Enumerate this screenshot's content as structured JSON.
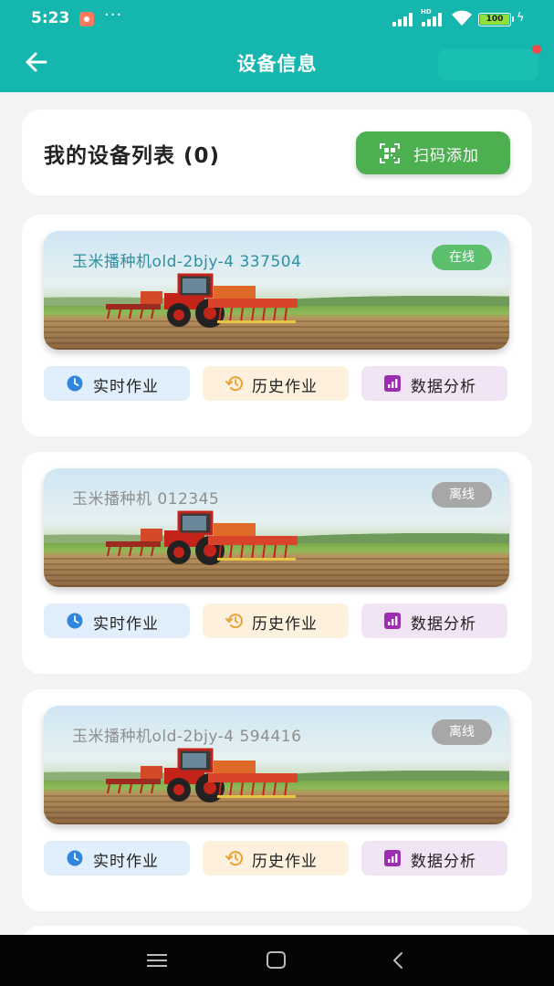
{
  "status_bar": {
    "time": "5:23",
    "more": "···",
    "hd": "HD",
    "battery": "100",
    "colors": {
      "recording_icon": "#ff7a5c",
      "battery_fill": "#8fe03a"
    }
  },
  "header": {
    "title": "设备信息",
    "background": "#15b6ad",
    "back_icon": "arrow-left-icon"
  },
  "device_list": {
    "title": "我的设备列表 (0)",
    "scan_button": {
      "label": "扫码添加",
      "icon": "qr-scan-icon",
      "color": "#4caf50"
    }
  },
  "devices": [
    {
      "name": "玉米播种机old-2bjy-4 337504",
      "status": "在线",
      "status_color": "#5cbf6e",
      "name_color": "#2f8fa2"
    },
    {
      "name": "玉米播种机 012345",
      "status": "离线",
      "status_color": "#a7a7a7",
      "name_color": "#8e8e8e"
    },
    {
      "name": "玉米播种机old-2bjy-4 594416",
      "status": "离线",
      "status_color": "#a7a7a7",
      "name_color": "#8e8e8e"
    }
  ],
  "actions": {
    "realtime": {
      "label": "实时作业",
      "icon": "clock-icon",
      "color": "#2f86de"
    },
    "history": {
      "label": "历史作业",
      "icon": "history-icon",
      "color": "#e8a23a"
    },
    "analysis": {
      "label": "数据分析",
      "icon": "bar-chart-icon",
      "color": "#9c2fb0"
    }
  },
  "navigation_bar": {
    "icons": [
      "menu-icon",
      "home-icon",
      "back-icon"
    ]
  }
}
